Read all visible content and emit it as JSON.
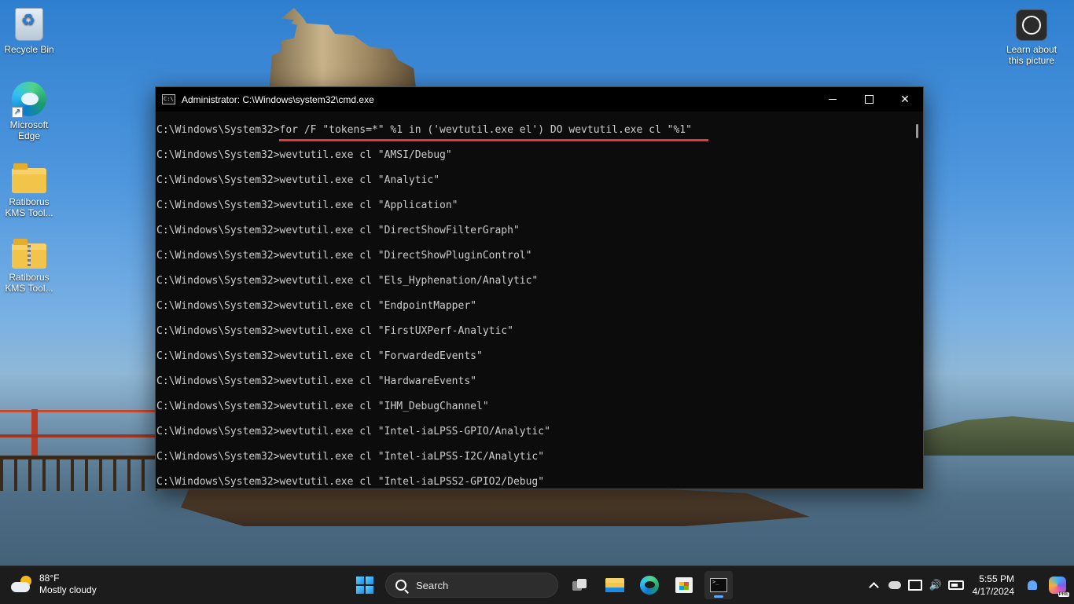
{
  "desktop": {
    "icons": [
      {
        "label": "Recycle Bin"
      },
      {
        "label": "Microsoft Edge"
      },
      {
        "label": "Ratiborus KMS Tool..."
      },
      {
        "label": "Ratiborus KMS Tool..."
      }
    ],
    "learn_about": "Learn about this picture"
  },
  "window": {
    "title": "Administrator: C:\\Windows\\system32\\cmd.exe",
    "icon_text": "C:\\",
    "lines": [
      "C:\\Windows\\System32>for /F \"tokens=*\" %1 in ('wevtutil.exe el') DO wevtutil.exe cl \"%1\"",
      "C:\\Windows\\System32>wevtutil.exe cl \"AMSI/Debug\"",
      "C:\\Windows\\System32>wevtutil.exe cl \"Analytic\"",
      "C:\\Windows\\System32>wevtutil.exe cl \"Application\"",
      "C:\\Windows\\System32>wevtutil.exe cl \"DirectShowFilterGraph\"",
      "C:\\Windows\\System32>wevtutil.exe cl \"DirectShowPluginControl\"",
      "C:\\Windows\\System32>wevtutil.exe cl \"Els_Hyphenation/Analytic\"",
      "C:\\Windows\\System32>wevtutil.exe cl \"EndpointMapper\"",
      "C:\\Windows\\System32>wevtutil.exe cl \"FirstUXPerf-Analytic\"",
      "C:\\Windows\\System32>wevtutil.exe cl \"ForwardedEvents\"",
      "C:\\Windows\\System32>wevtutil.exe cl \"HardwareEvents\"",
      "C:\\Windows\\System32>wevtutil.exe cl \"IHM_DebugChannel\"",
      "C:\\Windows\\System32>wevtutil.exe cl \"Intel-iaLPSS-GPIO/Analytic\"",
      "C:\\Windows\\System32>wevtutil.exe cl \"Intel-iaLPSS-I2C/Analytic\"",
      "C:\\Windows\\System32>wevtutil.exe cl \"Intel-iaLPSS2-GPIO2/Debug\""
    ],
    "highlight_color": "#e8383a"
  },
  "taskbar": {
    "weather": {
      "temp": "88°F",
      "condition": "Mostly cloudy"
    },
    "search_placeholder": "Search",
    "term_icon_text": ">_",
    "clock": {
      "time": "5:55 PM",
      "date": "4/17/2024"
    }
  }
}
